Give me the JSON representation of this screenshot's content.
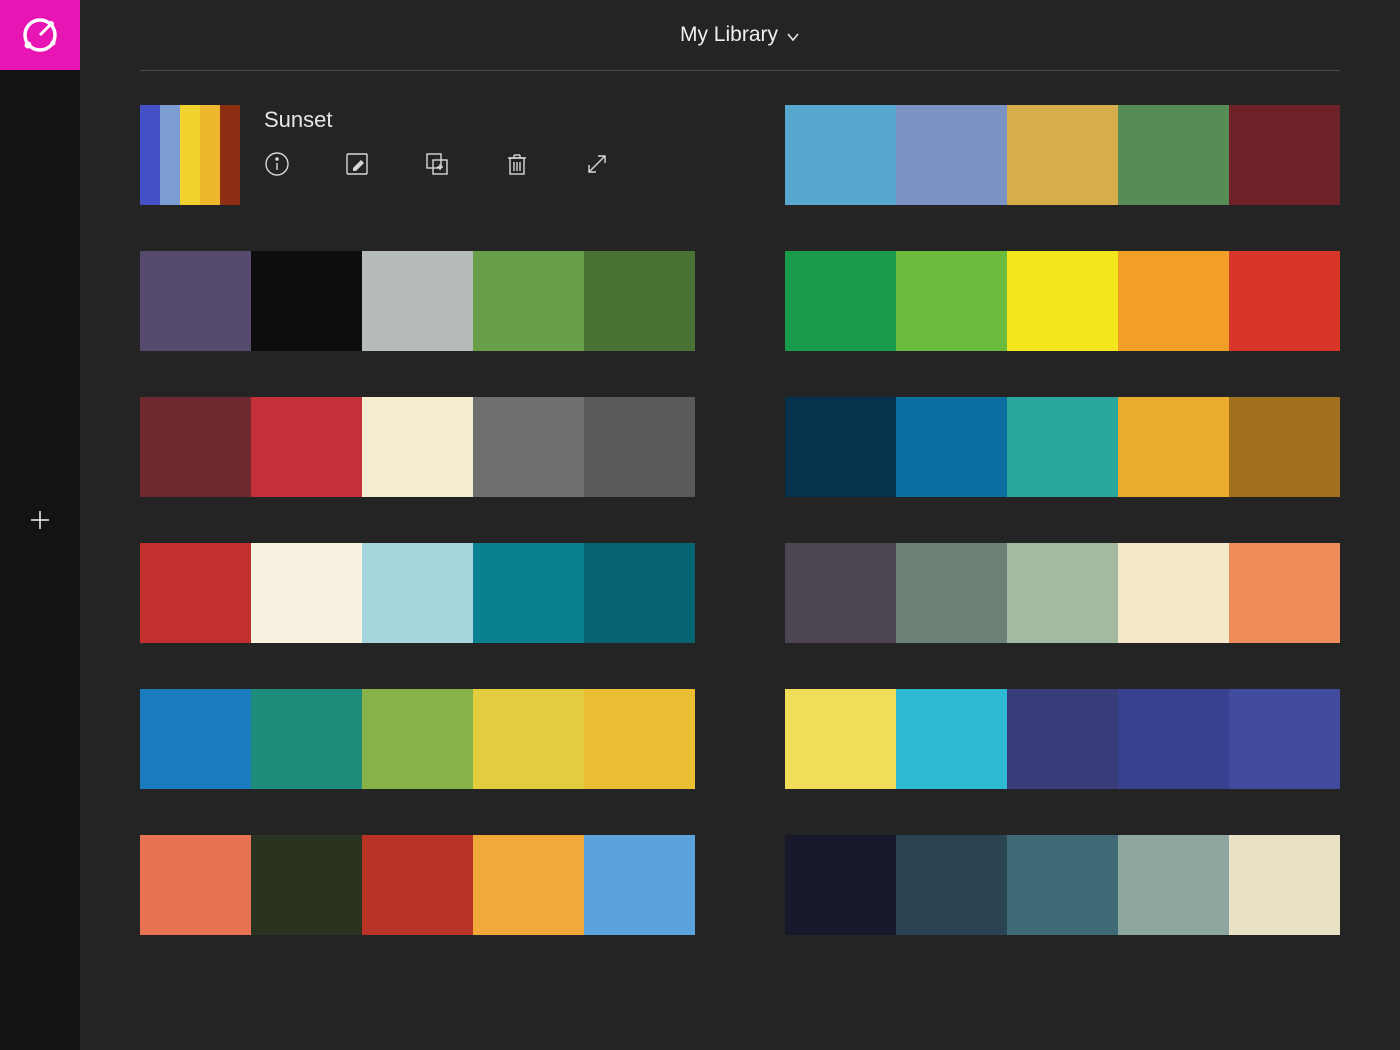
{
  "header": {
    "library_label": "My Library"
  },
  "selected": {
    "title": "Sunset",
    "actions": {
      "info": "info-icon",
      "edit": "edit-icon",
      "duplicate": "duplicate-icon",
      "delete": "trash-icon",
      "expand": "expand-icon"
    },
    "colors": [
      "#4451c6",
      "#7b9dd1",
      "#f2d22e",
      "#efb72d",
      "#8b2e11"
    ]
  },
  "palettes": [
    [
      "#57a7ce",
      "#7b92c5",
      "#d6ad4a",
      "#578c56",
      "#6e2129"
    ],
    [
      "#564a6e",
      "#0d0d0d",
      "#b6bdb9",
      "#68a049",
      "#477233"
    ],
    [
      "#1a9b49",
      "#6bbb3d",
      "#f4e61c",
      "#f29f27",
      "#d83628"
    ],
    [
      "#6e2a30",
      "#c4303a",
      "#f5edd1",
      "#6f6f6f",
      "#595959"
    ],
    [
      "#07324d",
      "#0b6ea0",
      "#2aa79b",
      "#eaac2c",
      "#a0701f"
    ],
    [
      "#c32f2f",
      "#f7f2e0",
      "#a5d5dd",
      "#0a8091",
      "#066370"
    ],
    [
      "#4c4451",
      "#6d8076",
      "#a3b9a1",
      "#f6e9cb",
      "#ee8d59"
    ],
    [
      "#1b7bbf",
      "#1f8c7b",
      "#86b249",
      "#e1cd3e",
      "#eabd33"
    ],
    [
      "#f0de5a",
      "#2fb9d3",
      "#383d7a",
      "#38418f",
      "#414c9f"
    ],
    [
      "#e87352",
      "#2a3320",
      "#b83226",
      "#f1a93a",
      "#5aa3dc"
    ],
    [
      "#17192b",
      "#2b4454",
      "#3f6a75",
      "#8ea6a0",
      "#e8e1c4"
    ]
  ]
}
